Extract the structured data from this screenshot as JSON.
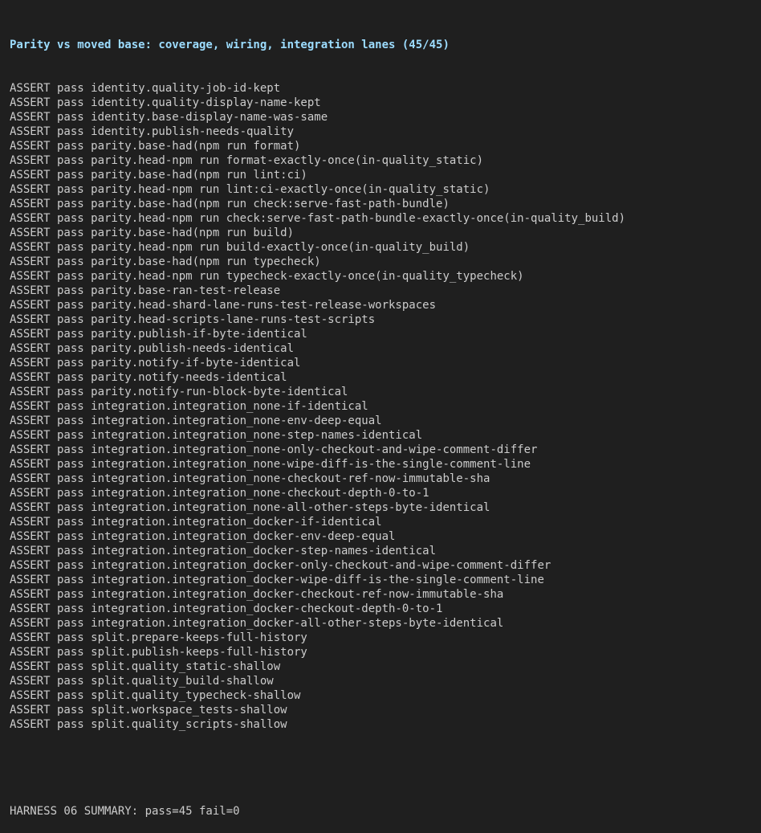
{
  "heading": "Parity vs moved base: coverage, wiring, integration lanes (45/45)",
  "assert_lines": [
    "ASSERT pass identity.quality-job-id-kept",
    "ASSERT pass identity.quality-display-name-kept",
    "ASSERT pass identity.base-display-name-was-same",
    "ASSERT pass identity.publish-needs-quality",
    "ASSERT pass parity.base-had(npm run format)",
    "ASSERT pass parity.head-npm run format-exactly-once(in-quality_static)",
    "ASSERT pass parity.base-had(npm run lint:ci)",
    "ASSERT pass parity.head-npm run lint:ci-exactly-once(in-quality_static)",
    "ASSERT pass parity.base-had(npm run check:serve-fast-path-bundle)",
    "ASSERT pass parity.head-npm run check:serve-fast-path-bundle-exactly-once(in-quality_build)",
    "ASSERT pass parity.base-had(npm run build)",
    "ASSERT pass parity.head-npm run build-exactly-once(in-quality_build)",
    "ASSERT pass parity.base-had(npm run typecheck)",
    "ASSERT pass parity.head-npm run typecheck-exactly-once(in-quality_typecheck)",
    "ASSERT pass parity.base-ran-test-release",
    "ASSERT pass parity.head-shard-lane-runs-test-release-workspaces",
    "ASSERT pass parity.head-scripts-lane-runs-test-scripts",
    "ASSERT pass parity.publish-if-byte-identical",
    "ASSERT pass parity.publish-needs-identical",
    "ASSERT pass parity.notify-if-byte-identical",
    "ASSERT pass parity.notify-needs-identical",
    "ASSERT pass parity.notify-run-block-byte-identical",
    "ASSERT pass integration.integration_none-if-identical",
    "ASSERT pass integration.integration_none-env-deep-equal",
    "ASSERT pass integration.integration_none-step-names-identical",
    "ASSERT pass integration.integration_none-only-checkout-and-wipe-comment-differ",
    "ASSERT pass integration.integration_none-wipe-diff-is-the-single-comment-line",
    "ASSERT pass integration.integration_none-checkout-ref-now-immutable-sha",
    "ASSERT pass integration.integration_none-checkout-depth-0-to-1",
    "ASSERT pass integration.integration_none-all-other-steps-byte-identical",
    "ASSERT pass integration.integration_docker-if-identical",
    "ASSERT pass integration.integration_docker-env-deep-equal",
    "ASSERT pass integration.integration_docker-step-names-identical",
    "ASSERT pass integration.integration_docker-only-checkout-and-wipe-comment-differ",
    "ASSERT pass integration.integration_docker-wipe-diff-is-the-single-comment-line",
    "ASSERT pass integration.integration_docker-checkout-ref-now-immutable-sha",
    "ASSERT pass integration.integration_docker-checkout-depth-0-to-1",
    "ASSERT pass integration.integration_docker-all-other-steps-byte-identical",
    "ASSERT pass split.prepare-keeps-full-history",
    "ASSERT pass split.publish-keeps-full-history",
    "ASSERT pass split.quality_static-shallow",
    "ASSERT pass split.quality_build-shallow",
    "ASSERT pass split.quality_typecheck-shallow",
    "ASSERT pass split.workspace_tests-shallow",
    "ASSERT pass split.quality_scripts-shallow"
  ],
  "summary": "HARNESS 06 SUMMARY: pass=45 fail=0",
  "colors": {
    "background": "#1f1f1f",
    "text": "#cccccc",
    "heading": "#9cdcfe"
  }
}
